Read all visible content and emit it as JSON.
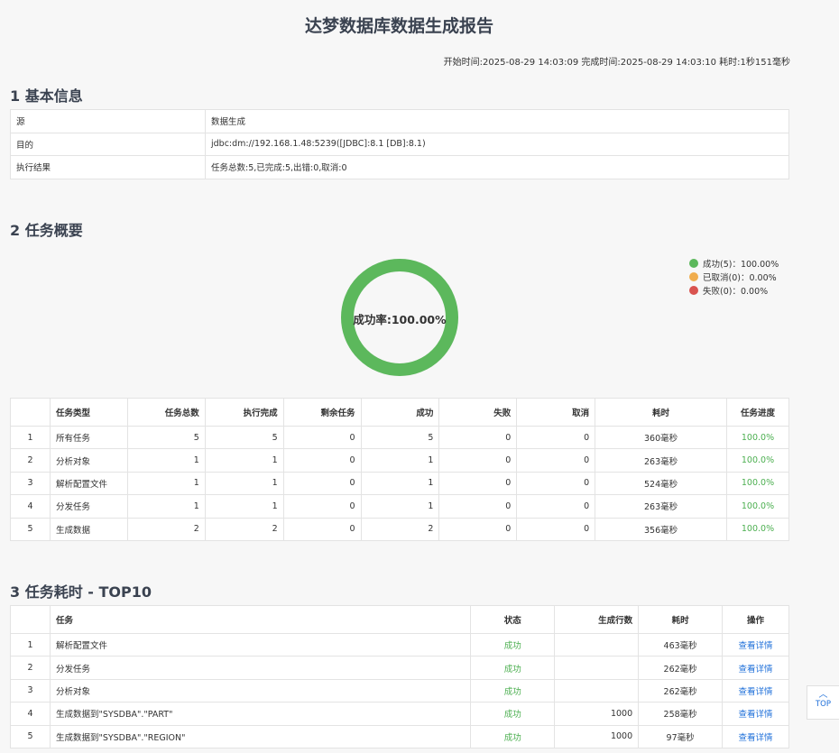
{
  "report": {
    "title": "达梦数据库数据生成报告",
    "timeline": "开始时间:2025-08-29 14:03:09 完成时间:2025-08-29 14:03:10 耗时:1秒151毫秒"
  },
  "basic_info": {
    "heading": "1 基本信息",
    "rows": [
      {
        "key": "源",
        "value": "数据生成"
      },
      {
        "key": "目的",
        "value": "jdbc:dm://192.168.1.48:5239([JDBC]:8.1 [DB]:8.1)"
      },
      {
        "key": "执行结果",
        "value": "任务总数:5,已完成:5,出错:0,取消:0"
      }
    ]
  },
  "overview": {
    "heading": "2 任务概要",
    "donut_label": "成功率:100.00%",
    "success_fraction": 1.0,
    "colors": {
      "success": "#5cb85c",
      "cancelled": "#f0ad4e",
      "failed": "#d9534f"
    },
    "legend": [
      {
        "label": "成功(5)：100.00%",
        "color": "#5cb85c"
      },
      {
        "label": "已取消(0)：0.00%",
        "color": "#f0ad4e"
      },
      {
        "label": "失败(0)：0.00%",
        "color": "#d9534f"
      }
    ],
    "columns": [
      "",
      "任务类型",
      "任务总数",
      "执行完成",
      "剩余任务",
      "成功",
      "失败",
      "取消",
      "耗时",
      "任务进度"
    ],
    "rows": [
      [
        "1",
        "所有任务",
        "5",
        "5",
        "0",
        "5",
        "0",
        "0",
        "360毫秒",
        "100.0%"
      ],
      [
        "2",
        "分析对象",
        "1",
        "1",
        "0",
        "1",
        "0",
        "0",
        "263毫秒",
        "100.0%"
      ],
      [
        "3",
        "解析配置文件",
        "1",
        "1",
        "0",
        "1",
        "0",
        "0",
        "524毫秒",
        "100.0%"
      ],
      [
        "4",
        "分发任务",
        "1",
        "1",
        "0",
        "1",
        "0",
        "0",
        "263毫秒",
        "100.0%"
      ],
      [
        "5",
        "生成数据",
        "2",
        "2",
        "0",
        "2",
        "0",
        "0",
        "356毫秒",
        "100.0%"
      ]
    ]
  },
  "top10": {
    "heading": "3 任务耗时 - TOP10",
    "columns": [
      "",
      "任务",
      "状态",
      "生成行数",
      "耗时",
      "操作"
    ],
    "rows": [
      [
        "1",
        "解析配置文件",
        "成功",
        "",
        "463毫秒",
        "查看详情"
      ],
      [
        "2",
        "分发任务",
        "成功",
        "",
        "262毫秒",
        "查看详情"
      ],
      [
        "3",
        "分析对象",
        "成功",
        "",
        "262毫秒",
        "查看详情"
      ],
      [
        "4",
        "生成数据到\"SYSDBA\".\"PART\"",
        "成功",
        "1000",
        "258毫秒",
        "查看详情"
      ],
      [
        "5",
        "生成数据到\"SYSDBA\".\"REGION\"",
        "成功",
        "1000",
        "97毫秒",
        "查看详情"
      ]
    ]
  },
  "top_button": {
    "label": "TOP",
    "icon": "chevron-up-icon"
  }
}
